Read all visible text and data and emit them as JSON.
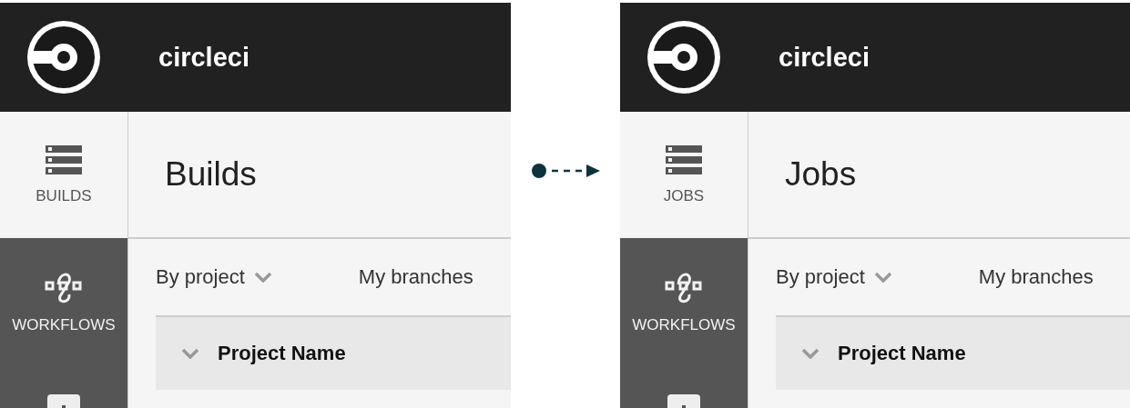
{
  "panels": [
    {
      "brand": "circleci",
      "nav": [
        {
          "label": "BUILDS",
          "kind": "list",
          "selected": true
        },
        {
          "label": "WORKFLOWS",
          "kind": "workflow",
          "selected": false
        },
        {
          "kind": "plus",
          "selected": false
        }
      ],
      "title": "Builds",
      "filters": [
        {
          "label": "By project",
          "has_menu": true
        },
        {
          "label": "My branches",
          "has_menu": false
        }
      ],
      "table": {
        "columns": [
          {
            "label": "Project Name",
            "expanded": true
          }
        ]
      }
    },
    {
      "brand": "circleci",
      "nav": [
        {
          "label": "JOBS",
          "kind": "list",
          "selected": true
        },
        {
          "label": "WORKFLOWS",
          "kind": "workflow",
          "selected": false
        },
        {
          "kind": "plus",
          "selected": false
        }
      ],
      "title": "Jobs",
      "filters": [
        {
          "label": "By project",
          "has_menu": true
        },
        {
          "label": "My branches",
          "has_menu": false
        }
      ],
      "table": {
        "columns": [
          {
            "label": "Project Name",
            "expanded": true
          }
        ]
      }
    }
  ]
}
